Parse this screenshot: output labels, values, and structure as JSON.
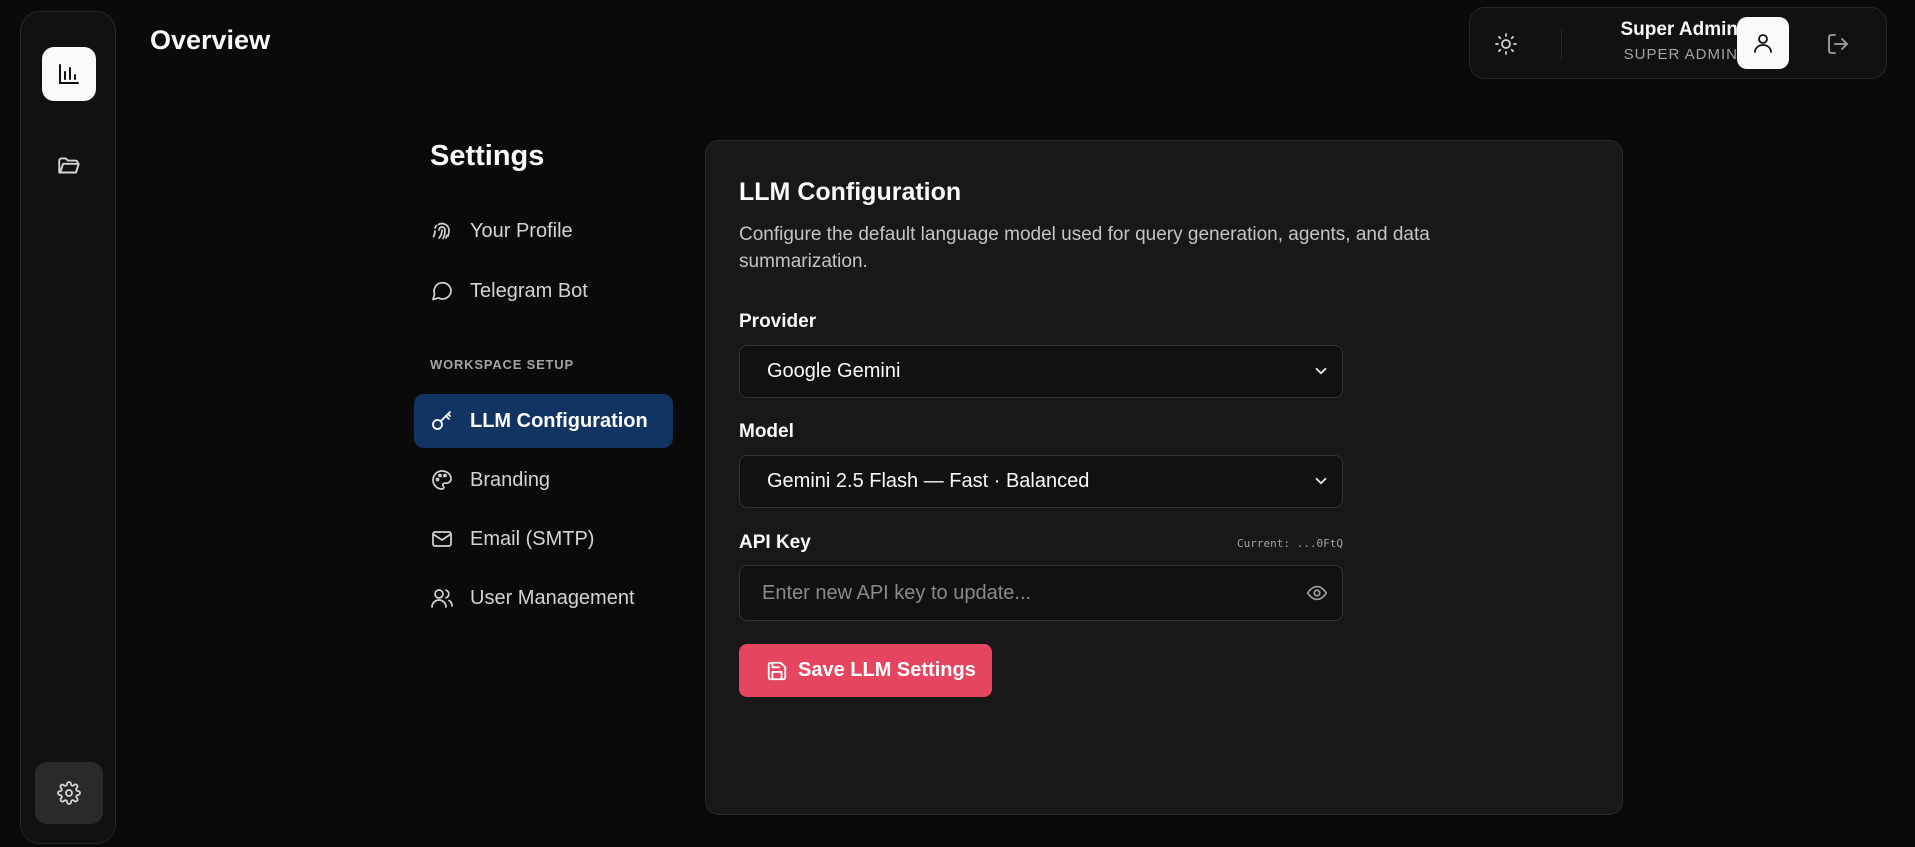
{
  "header": {
    "title": "Overview"
  },
  "rail": {
    "items": [
      {
        "icon": "bar-chart-icon",
        "active": true
      },
      {
        "icon": "folder-open-icon",
        "active": false
      },
      {
        "icon": "gear-icon",
        "active": false
      }
    ]
  },
  "user": {
    "name": "Super Admin",
    "role": "SUPER ADMIN",
    "theme_icon": "sun-icon",
    "avatar_icon": "user-icon",
    "logout_icon": "logout-icon"
  },
  "settings": {
    "title": "Settings",
    "nav": [
      {
        "label": "Your Profile",
        "icon": "fingerprint-icon"
      },
      {
        "label": "Telegram Bot",
        "icon": "message-circle-icon"
      }
    ],
    "section_label": "WORKSPACE SETUP",
    "workspace_nav": [
      {
        "label": "LLM Configuration",
        "icon": "key-icon",
        "active": true
      },
      {
        "label": "Branding",
        "icon": "palette-icon"
      },
      {
        "label": "Email (SMTP)",
        "icon": "mail-icon"
      },
      {
        "label": "User Management",
        "icon": "users-icon"
      }
    ]
  },
  "llm": {
    "title": "LLM Configuration",
    "description": "Configure the default language model used for query generation, agents, and data summarization.",
    "provider_label": "Provider",
    "provider_value": "Google Gemini",
    "model_label": "Model",
    "model_value": "Gemini 2.5 Flash — Fast · Balanced",
    "api_key_label": "API Key",
    "api_key_current": "Current: ...0FtQ",
    "api_key_placeholder": "Enter new API key to update...",
    "save_label": "Save LLM Settings"
  },
  "colors": {
    "accent": "#e5455f",
    "active_nav": "#123463",
    "background": "#0a0a0a",
    "card": "#181818"
  }
}
